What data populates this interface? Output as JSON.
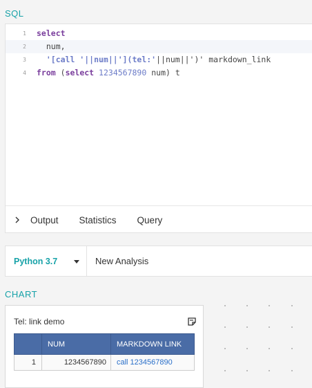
{
  "sql_section": {
    "label": "SQL"
  },
  "editor": {
    "lines": [
      {
        "n": "1"
      },
      {
        "n": "2"
      },
      {
        "n": "3"
      },
      {
        "n": "4"
      }
    ],
    "tokens": {
      "l1_kw": "select",
      "l2_text": "  num,",
      "l3_str": "  '[call '||num||'](tel:'",
      "l3_rest": "||num||')' markdown_link",
      "l4_kw1": "from",
      "l4_p1": " (",
      "l4_kw2": "select",
      "l4_sp": " ",
      "l4_num": "1234567890",
      "l4_rest": " num) t"
    }
  },
  "results_tabs": {
    "output": "Output",
    "statistics": "Statistics",
    "query": "Query"
  },
  "kernel": {
    "selected": "Python 3.7",
    "analysis_name": "New Analysis"
  },
  "chart_section": {
    "label": "CHART",
    "title": "Tel: link demo",
    "table": {
      "headers": [
        "",
        "NUM",
        "MARKDOWN LINK"
      ],
      "rows": [
        {
          "idx": "1",
          "num": "1234567890",
          "link": "call 1234567890"
        }
      ]
    }
  },
  "icons": {
    "chevron": "chevron-right-icon",
    "caret": "caret-down-icon",
    "menu": "chart-menu-icon"
  },
  "colors": {
    "accent": "#17a2a8",
    "keyword": "#7a3e9d",
    "string": "#6c7cc8",
    "table_header": "#4a6ca6",
    "link": "#2a6fc9"
  }
}
